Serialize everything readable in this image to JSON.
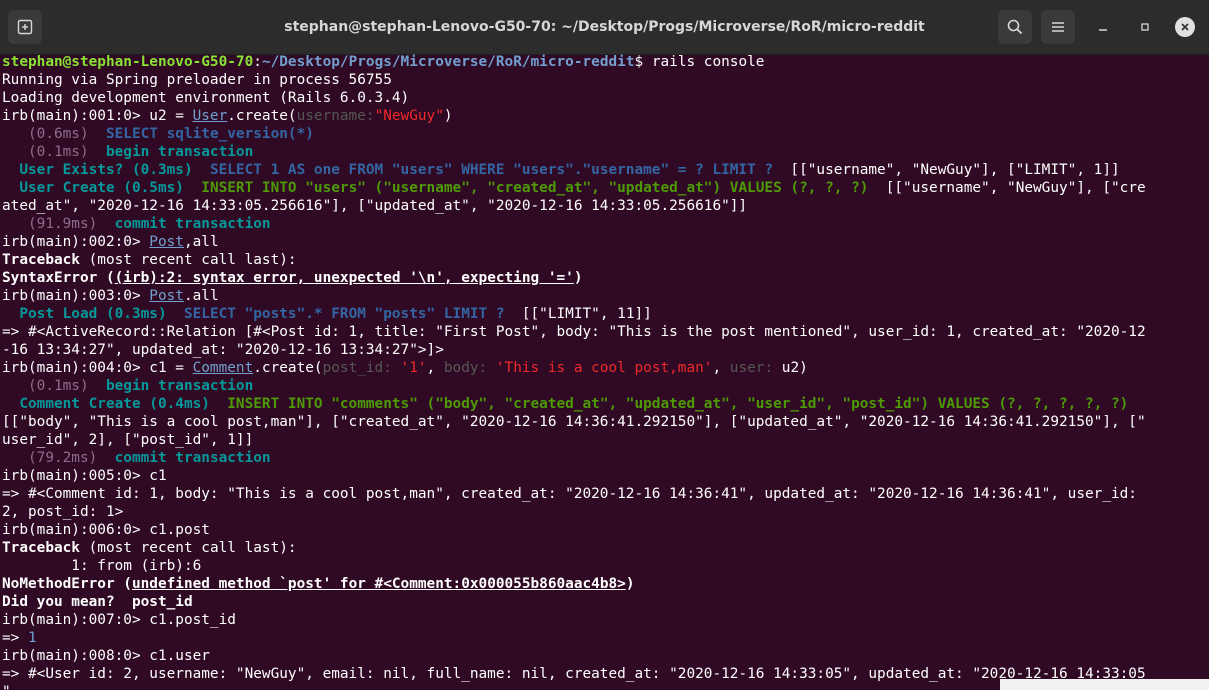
{
  "titlebar": {
    "title": "stephan@stephan-Lenovo-G50-70: ~/Desktop/Progs/Microverse/RoR/micro-reddit",
    "buttons": [
      "new-tab-icon",
      "search-icon",
      "hamburger-menu-icon",
      "minimize-icon",
      "maximize-icon",
      "close-icon"
    ]
  },
  "colors": {
    "background": "#300a24",
    "prompt_user": "#8ae234",
    "prompt_path": "#729fcf",
    "string": "#ef2929",
    "timing": "#8c6d8a",
    "sql_cyan": "#06989a",
    "sql_blue": "#3465a4",
    "sql_green": "#4e9a06"
  },
  "terminal": {
    "l01": {
      "user": "stephan@stephan-Lenovo-G50-70",
      "colon": ":",
      "path": "~/Desktop/Progs/Microverse/RoR/micro-reddit",
      "rest": "$ rails console"
    },
    "l02": {
      "text": "Running via Spring preloader in process 56755"
    },
    "l03": {
      "text": "Loading development environment (Rails 6.0.3.4)"
    },
    "l04": {
      "a": "irb(main):001:0> u2 = ",
      "cls": "User",
      "b": ".create(",
      "k": "username:",
      "s": "\"NewGuy\"",
      "c": ")"
    },
    "l05": {
      "ms": "   (0.6ms)  ",
      "sql": "SELECT sqlite_version(*)"
    },
    "l06": {
      "ms": "   (0.1ms)  ",
      "sql": "begin transaction"
    },
    "l07": {
      "pre": "  ",
      "lbl": "User Exists? (0.3ms)",
      "sp": "  ",
      "sql": "SELECT 1 AS one FROM \"users\" WHERE \"users\".\"username\" = ? LIMIT ?",
      "rest": "  [[\"username\", \"NewGuy\"], [\"LIMIT\", 1]]"
    },
    "l08": {
      "pre": "  ",
      "lbl": "User Create (0.5ms)",
      "sp": "  ",
      "sql": "INSERT INTO \"users\" (\"username\", \"created_at\", \"updated_at\") VALUES (?, ?, ?)",
      "rest": "  [[\"username\", \"NewGuy\"], [\"cre"
    },
    "l09": {
      "text": "ated_at\", \"2020-12-16 14:33:05.256616\"], [\"updated_at\", \"2020-12-16 14:33:05.256616\"]]"
    },
    "l10": {
      "ms": "   (91.9ms)  ",
      "sql": "commit transaction"
    },
    "l11": {
      "a": "irb(main):002:0> ",
      "cls": "Post",
      "b": ",all"
    },
    "l12": {
      "bold": "Traceback",
      "rest": " (most recent call last):"
    },
    "l13": {
      "bold": "SyntaxError (",
      "bu": "(irb):2: syntax error, unexpected '\\n', expecting '='",
      "bold2": ")"
    },
    "l14": {
      "a": "irb(main):003:0> ",
      "cls": "Post",
      "b": ".all"
    },
    "l15": {
      "pre": "  ",
      "lbl": "Post Load (0.3ms)",
      "sp": "  ",
      "sql": "SELECT \"posts\".* FROM \"posts\" LIMIT ?",
      "rest": "  [[\"LIMIT\", 11]]"
    },
    "l16": {
      "text": "=> #<ActiveRecord::Relation [#<Post id: 1, title: \"First Post\", body: \"This is the post mentioned\", user_id: 1, created_at: \"2020-12"
    },
    "l17": {
      "text": "-16 13:34:27\", updated_at: \"2020-12-16 13:34:27\">]>"
    },
    "l18": {
      "a": "irb(main):004:0> c1 = ",
      "cls": "Comment",
      "b": ".create(",
      "k1": "post_id:",
      "s1": " '1'",
      "c1": ", ",
      "k2": "body:",
      "s2": " 'This is a cool post,man'",
      "c2": ", ",
      "k3": "user:",
      "tail": " u2)"
    },
    "l19": {
      "ms": "   (0.1ms)  ",
      "sql": "begin transaction"
    },
    "l20": {
      "pre": "  ",
      "lbl": "Comment Create (0.4ms)",
      "sp": "  ",
      "sql": "INSERT INTO \"comments\" (\"body\", \"created_at\", \"updated_at\", \"user_id\", \"post_id\") VALUES (?, ?, ?, ?, ?)"
    },
    "l21": {
      "text": "[[\"body\", \"This is a cool post,man\"], [\"created_at\", \"2020-12-16 14:36:41.292150\"], [\"updated_at\", \"2020-12-16 14:36:41.292150\"], [\""
    },
    "l22": {
      "text": "user_id\", 2], [\"post_id\", 1]]"
    },
    "l23": {
      "ms": "   (79.2ms)  ",
      "sql": "commit transaction"
    },
    "l24": {
      "text": "irb(main):005:0> c1"
    },
    "l25": {
      "text": "=> #<Comment id: 1, body: \"This is a cool post,man\", created_at: \"2020-12-16 14:36:41\", updated_at: \"2020-12-16 14:36:41\", user_id:"
    },
    "l26": {
      "text": "2, post_id: 1>"
    },
    "l27": {
      "text": "irb(main):006:0> c1.post"
    },
    "l28": {
      "bold": "Traceback",
      "rest": " (most recent call last):"
    },
    "l29": {
      "text": "        1: from (irb):6"
    },
    "l30": {
      "bold": "NoMethodError (",
      "bu": "undefined method `post' for #<Comment:0x000055b860aac4b8>",
      "bold2": ")"
    },
    "l31": {
      "bold": "Did you mean?  post_id"
    },
    "l32": {
      "text": "irb(main):007:0> c1.post_id"
    },
    "l33": {
      "a": "=> ",
      "num": "1"
    },
    "l34": {
      "text": "irb(main):008:0> c1.user"
    },
    "l35": {
      "text": "=> #<User id: 2, username: \"NewGuy\", email: nil, full_name: nil, created_at: \"2020-12-16 14:33:05\", updated_at: \"2020-12-16 14:33:05"
    },
    "l36": {
      "text": "\""
    }
  }
}
